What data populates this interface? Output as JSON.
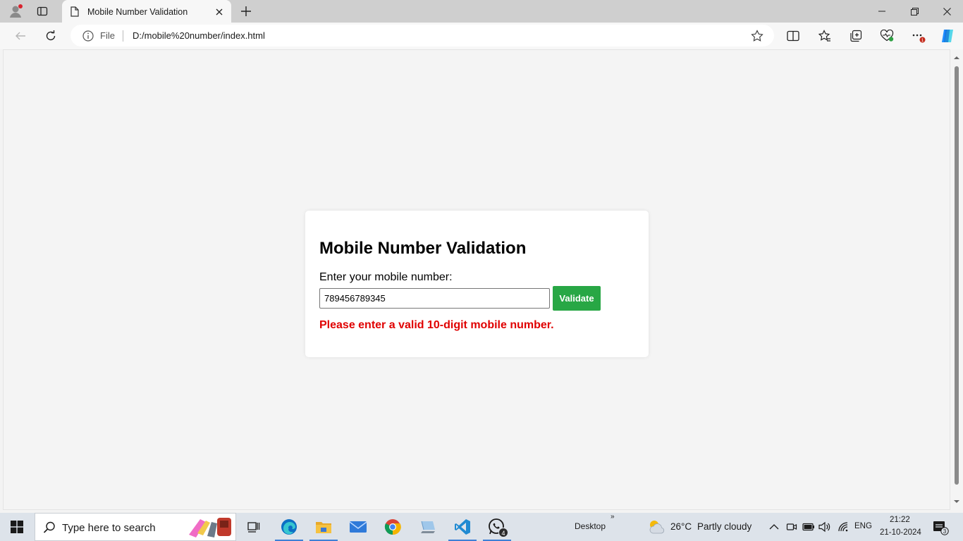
{
  "browser": {
    "tab_title": "Mobile Number Validation",
    "address_scheme_label": "File",
    "address_url": "D:/mobile%20number/index.html"
  },
  "page": {
    "heading": "Mobile Number Validation",
    "input_label": "Enter your mobile number:",
    "input_value": "789456789345",
    "button_label": "Validate",
    "error_message": "Please enter a valid 10-digit mobile number.",
    "colors": {
      "button": "#28a745",
      "error": "#e00000",
      "background": "#f4f4f4"
    }
  },
  "taskbar": {
    "search_placeholder": "Type here to search",
    "desktop_label": "Desktop",
    "desktop_chevron": "»",
    "temperature": "26°C",
    "weather_condition": "Partly cloudy",
    "language": "ENG",
    "time": "21:22",
    "date": "21-10-2024",
    "whatsapp_badge": "4",
    "notification_count": "3",
    "apps": [
      "task-view",
      "edge",
      "file-explorer",
      "mail",
      "chrome",
      "computer",
      "vscode",
      "whatsapp"
    ]
  }
}
